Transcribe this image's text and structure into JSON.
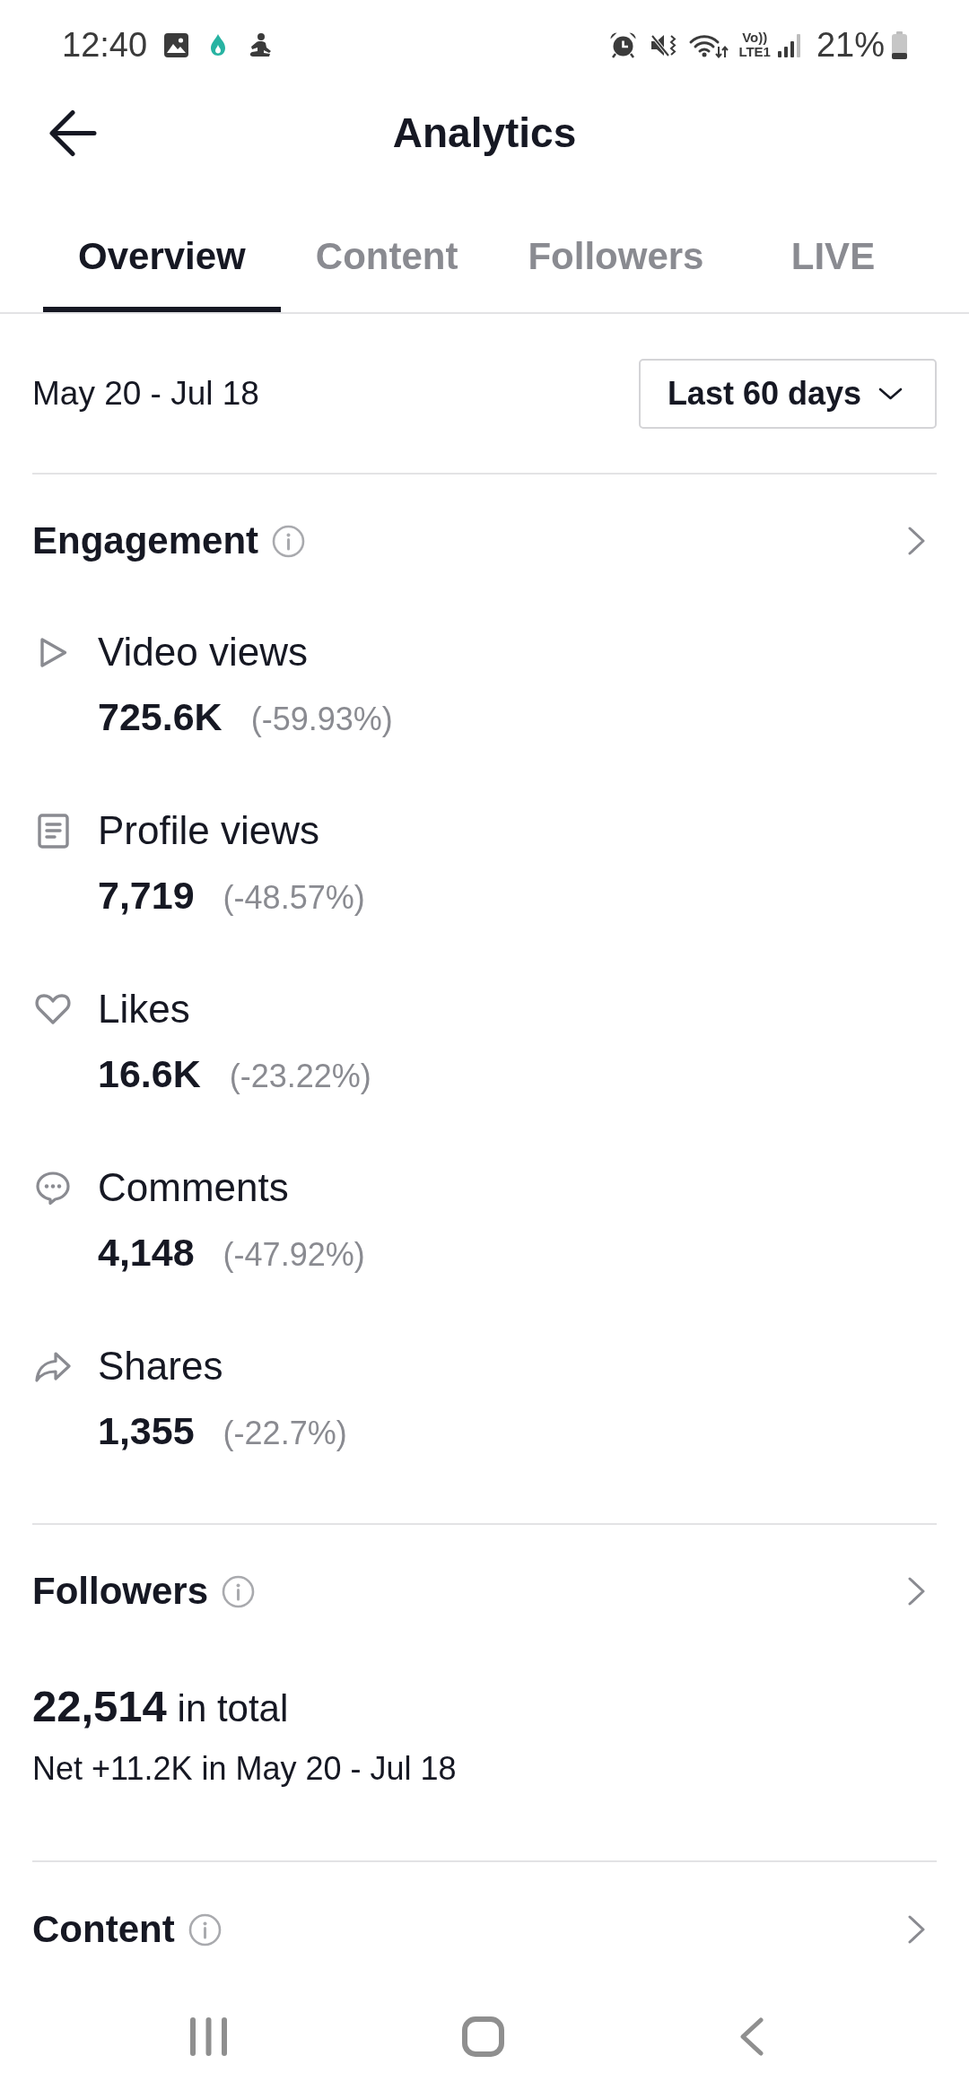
{
  "status_bar": {
    "time": "12:40",
    "network_top": "Vo))",
    "network_bottom": "LTE1",
    "battery": "21%"
  },
  "header": {
    "title": "Analytics"
  },
  "tabs": [
    {
      "label": "Overview",
      "selected": true
    },
    {
      "label": "Content",
      "selected": false
    },
    {
      "label": "Followers",
      "selected": false
    },
    {
      "label": "LIVE",
      "selected": false
    }
  ],
  "date_filter": {
    "range": "May 20 - Jul 18",
    "period": "Last 60 days"
  },
  "engagement": {
    "title": "Engagement",
    "metrics": [
      {
        "kind": "views",
        "label": "Video views",
        "value": "725.6K",
        "change": "(-59.93%)"
      },
      {
        "kind": "profile",
        "label": "Profile views",
        "value": "7,719",
        "change": "(-48.57%)"
      },
      {
        "kind": "likes",
        "label": "Likes",
        "value": "16.6K",
        "change": "(-23.22%)"
      },
      {
        "kind": "comments",
        "label": "Comments",
        "value": "4,148",
        "change": "(-47.92%)"
      },
      {
        "kind": "shares",
        "label": "Shares",
        "value": "1,355",
        "change": "(-22.7%)"
      }
    ]
  },
  "followers": {
    "title": "Followers",
    "total": "**22,514** in total",
    "net": "Net +11.2K in May 20 - Jul 18"
  },
  "content": {
    "title": "Content"
  }
}
